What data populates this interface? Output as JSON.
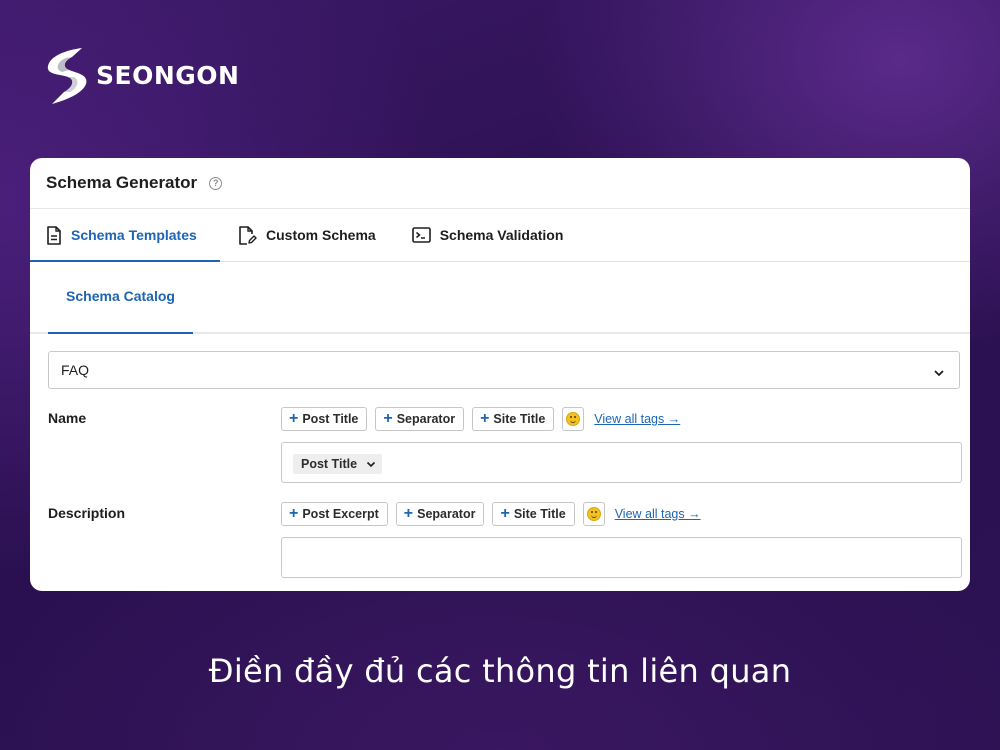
{
  "brand": {
    "name": "SEONGON"
  },
  "card": {
    "title": "Schema Generator",
    "help_icon": "question-circle-icon",
    "tabs": [
      {
        "label": "Schema Templates",
        "icon": "document-icon",
        "active": true
      },
      {
        "label": "Custom Schema",
        "icon": "edit-document-icon",
        "active": false
      },
      {
        "label": "Schema Validation",
        "icon": "terminal-icon",
        "active": false
      }
    ],
    "sub_tabs": [
      {
        "label": "Schema Catalog",
        "active": true
      }
    ],
    "schema_select": {
      "value": "FAQ"
    },
    "fields": {
      "name": {
        "label": "Name",
        "tags": [
          "Post Title",
          "Separator",
          "Site Title"
        ],
        "view_all": "View all tags →",
        "chip": "Post Title"
      },
      "description": {
        "label": "Description",
        "tags": [
          "Post Excerpt",
          "Separator",
          "Site Title"
        ],
        "view_all": "View all tags →",
        "value": ""
      }
    }
  },
  "caption": "Điền đầy đủ các thông tin liên quan",
  "colors": {
    "accent": "#1e64b4",
    "background": "#2a1050",
    "card": "#ffffff"
  }
}
